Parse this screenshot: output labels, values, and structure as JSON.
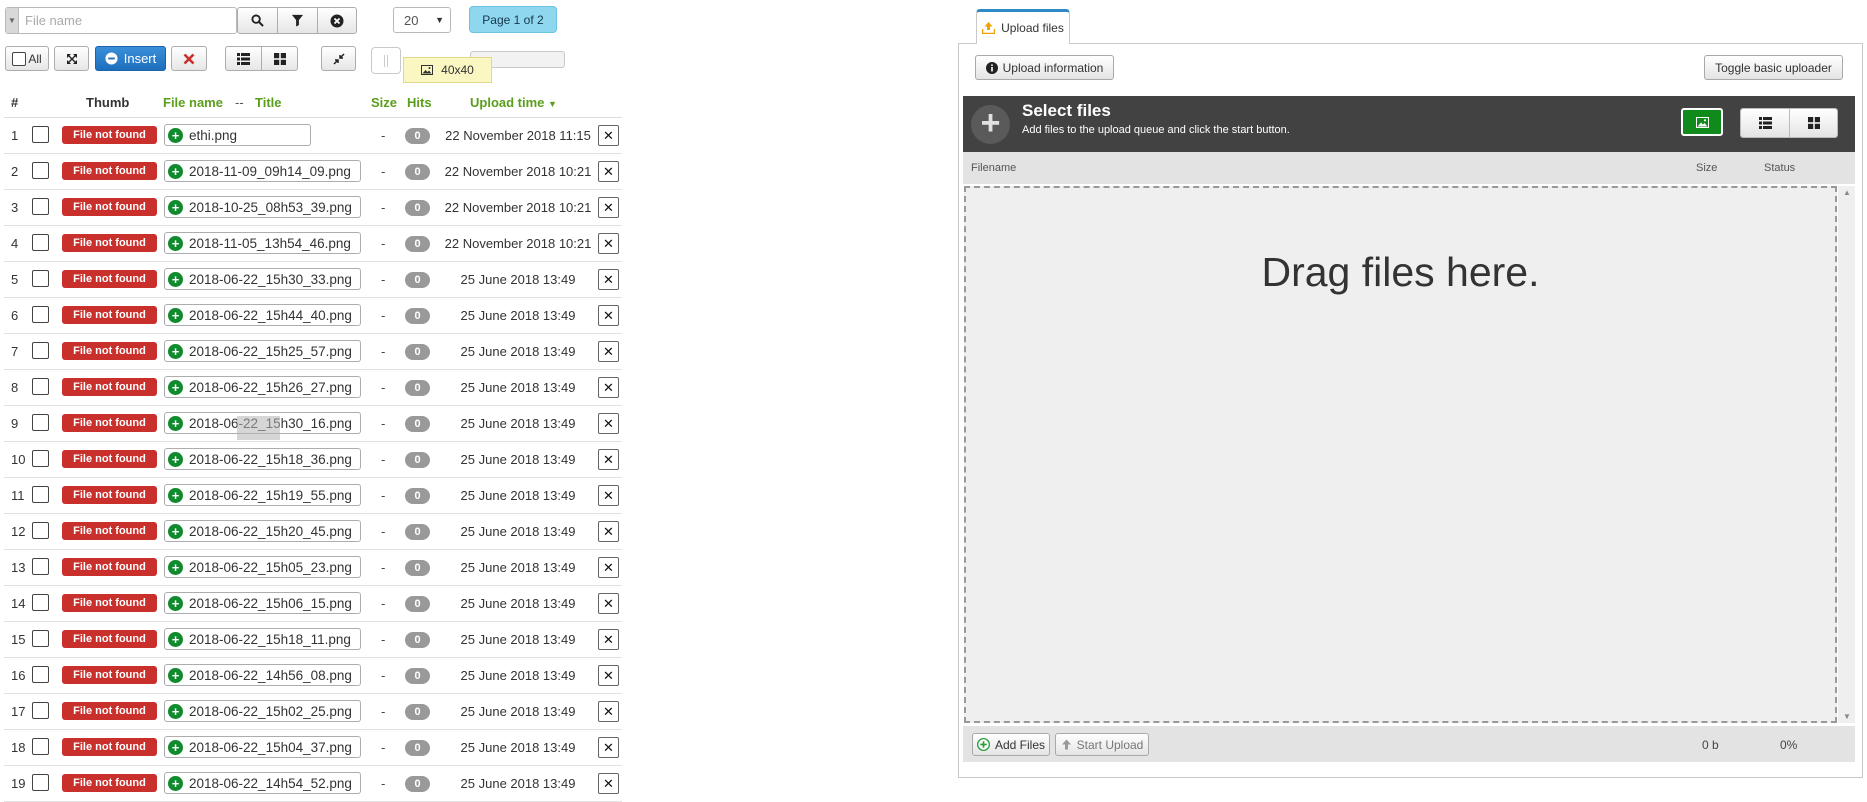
{
  "toolbar": {
    "search_placeholder": "File name",
    "search_value": "",
    "per_page": "20",
    "pager": "Page 1 of 2",
    "all_label": "All",
    "insert_label": "Insert",
    "thumb_size": "40x40"
  },
  "table": {
    "headers": {
      "num": "#",
      "thumb": "Thumb",
      "filename": "File name",
      "sep": "--",
      "title": "Title",
      "size": "Size",
      "hits": "Hits",
      "upload_time": "Upload time"
    },
    "rows": [
      {
        "num": "1",
        "badge": "File not found",
        "file": "ethi.png",
        "size": "-",
        "hits": "0",
        "time": "22 November 2018 11:15"
      },
      {
        "num": "2",
        "badge": "File not found",
        "file": "2018-11-09_09h14_09.png",
        "size": "-",
        "hits": "0",
        "time": "22 November 2018 10:21"
      },
      {
        "num": "3",
        "badge": "File not found",
        "file": "2018-10-25_08h53_39.png",
        "size": "-",
        "hits": "0",
        "time": "22 November 2018 10:21"
      },
      {
        "num": "4",
        "badge": "File not found",
        "file": "2018-11-05_13h54_46.png",
        "size": "-",
        "hits": "0",
        "time": "22 November 2018 10:21"
      },
      {
        "num": "5",
        "badge": "File not found",
        "file": "2018-06-22_15h30_33.png",
        "size": "-",
        "hits": "0",
        "time": "25 June 2018 13:49"
      },
      {
        "num": "6",
        "badge": "File not found",
        "file": "2018-06-22_15h44_40.png",
        "size": "-",
        "hits": "0",
        "time": "25 June 2018 13:49"
      },
      {
        "num": "7",
        "badge": "File not found",
        "file": "2018-06-22_15h25_57.png",
        "size": "-",
        "hits": "0",
        "time": "25 June 2018 13:49"
      },
      {
        "num": "8",
        "badge": "File not found",
        "file": "2018-06-22_15h26_27.png",
        "size": "-",
        "hits": "0",
        "time": "25 June 2018 13:49"
      },
      {
        "num": "9",
        "badge": "File not found",
        "file": "2018-06-22_15h30_16.png",
        "size": "-",
        "hits": "0",
        "time": "25 June 2018 13:49"
      },
      {
        "num": "10",
        "badge": "File not found",
        "file": "2018-06-22_15h18_36.png",
        "size": "-",
        "hits": "0",
        "time": "25 June 2018 13:49"
      },
      {
        "num": "11",
        "badge": "File not found",
        "file": "2018-06-22_15h19_55.png",
        "size": "-",
        "hits": "0",
        "time": "25 June 2018 13:49"
      },
      {
        "num": "12",
        "badge": "File not found",
        "file": "2018-06-22_15h20_45.png",
        "size": "-",
        "hits": "0",
        "time": "25 June 2018 13:49"
      },
      {
        "num": "13",
        "badge": "File not found",
        "file": "2018-06-22_15h05_23.png",
        "size": "-",
        "hits": "0",
        "time": "25 June 2018 13:49"
      },
      {
        "num": "14",
        "badge": "File not found",
        "file": "2018-06-22_15h06_15.png",
        "size": "-",
        "hits": "0",
        "time": "25 June 2018 13:49"
      },
      {
        "num": "15",
        "badge": "File not found",
        "file": "2018-06-22_15h18_11.png",
        "size": "-",
        "hits": "0",
        "time": "25 June 2018 13:49"
      },
      {
        "num": "16",
        "badge": "File not found",
        "file": "2018-06-22_14h56_08.png",
        "size": "-",
        "hits": "0",
        "time": "25 June 2018 13:49"
      },
      {
        "num": "17",
        "badge": "File not found",
        "file": "2018-06-22_15h02_25.png",
        "size": "-",
        "hits": "0",
        "time": "25 June 2018 13:49"
      },
      {
        "num": "18",
        "badge": "File not found",
        "file": "2018-06-22_15h04_37.png",
        "size": "-",
        "hits": "0",
        "time": "25 June 2018 13:49"
      },
      {
        "num": "19",
        "badge": "File not found",
        "file": "2018-06-22_14h54_52.png",
        "size": "-",
        "hits": "0",
        "time": "25 June 2018 13:49"
      }
    ]
  },
  "uploader": {
    "tab_label": "Upload files",
    "upload_info_label": "Upload information",
    "toggle_label": "Toggle basic uploader",
    "select_title": "Select files",
    "select_sub": "Add files to the upload queue and click the start button.",
    "col_filename": "Filename",
    "col_size": "Size",
    "col_status": "Status",
    "drop_text": "Drag files here.",
    "add_files_label": "Add Files",
    "start_upload_label": "Start Upload",
    "total_size": "0 b",
    "total_percent": "0%"
  },
  "colors": {
    "accent_green": "#5a9e1b",
    "badge_red": "#c9302c",
    "insert_blue": "#1d6fbd",
    "pager_blue": "#8fd6ef",
    "header_dark": "#424242",
    "tab_accent": "#2e8ac7"
  },
  "icons": [
    "search-icon",
    "filter-icon",
    "clear-circle-icon",
    "expand-icon",
    "minus-circle-icon",
    "delete-x-icon",
    "list-view-icon",
    "grid-view-icon",
    "collapse-icon",
    "image-icon",
    "plus-circle-icon",
    "upload-icon",
    "info-icon",
    "plus-icon",
    "arrow-up-icon",
    "sort-desc-icon"
  ]
}
